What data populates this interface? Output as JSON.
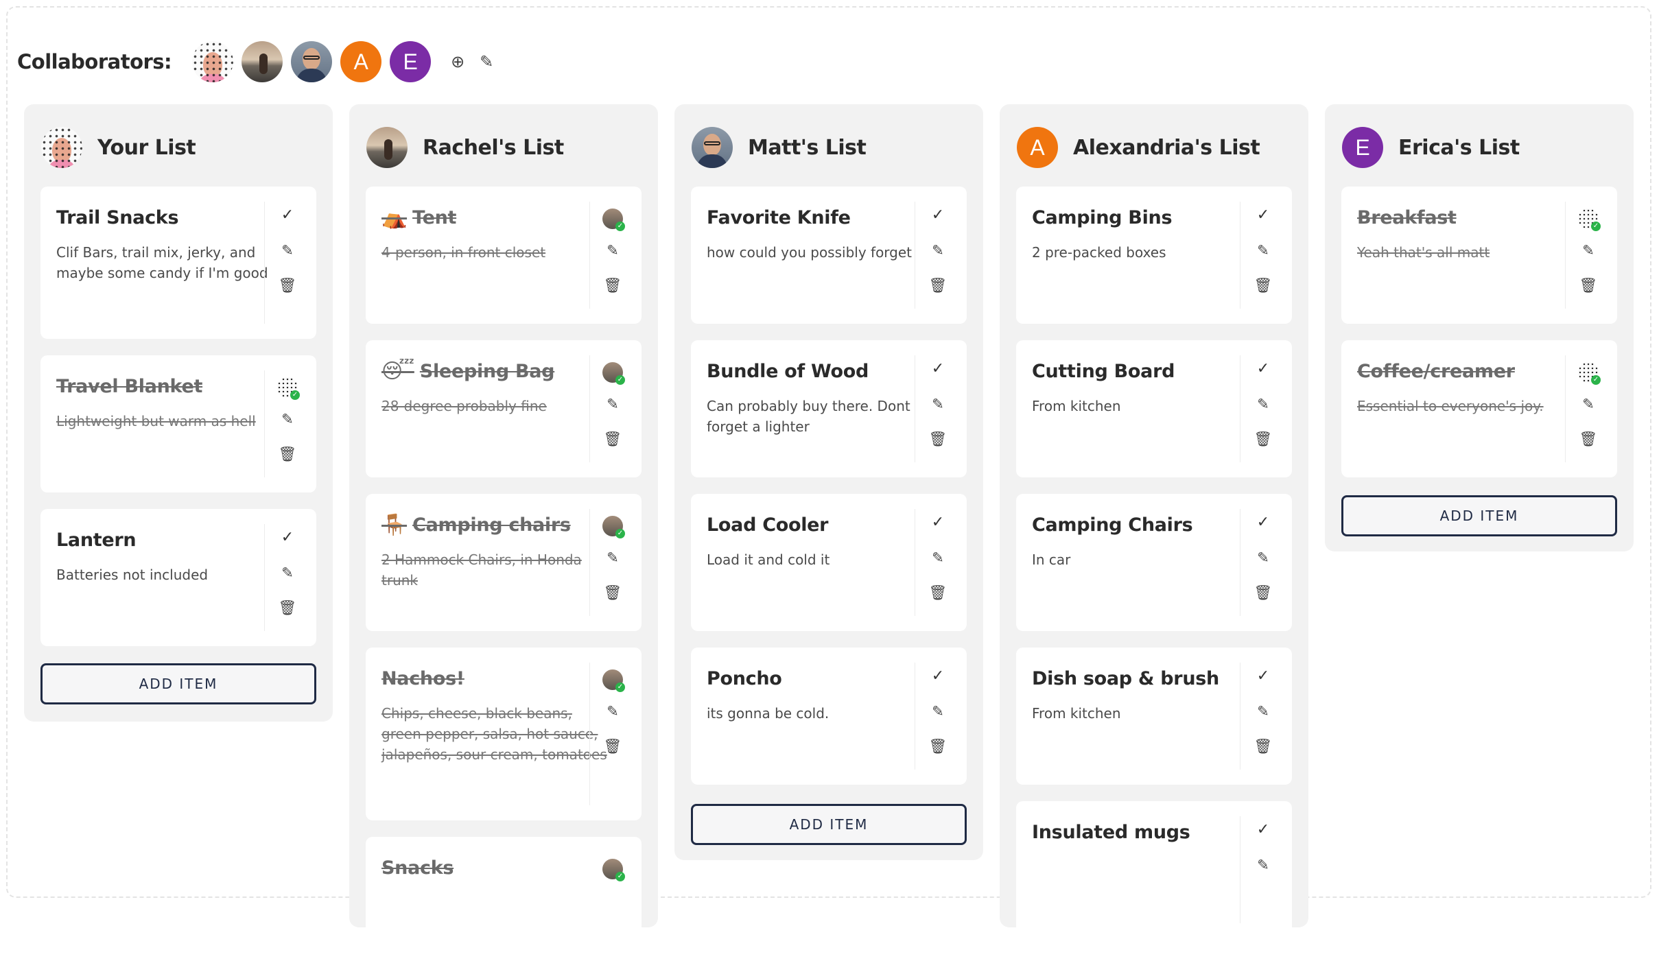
{
  "collaborators": {
    "title": "Collaborators:",
    "avatars": [
      {
        "name": "you",
        "letter": ""
      },
      {
        "name": "rachel",
        "letter": ""
      },
      {
        "name": "matt",
        "letter": ""
      },
      {
        "name": "alexandria",
        "letter": "A",
        "color": "#f0750f"
      },
      {
        "name": "erica",
        "letter": "E",
        "color": "#7b2ca6"
      }
    ],
    "add_icon": "plus-circle-icon",
    "edit_icon": "pencil-icon"
  },
  "columns": [
    {
      "title": "Your List",
      "cards": [
        {
          "title": "Trail Snacks",
          "desc": "Clif Bars, trail mix, jerky, and maybe some candy if I'm good",
          "done": false
        },
        {
          "title": "Travel Blanket",
          "desc": "Lightweight but warm as hell",
          "done": true
        },
        {
          "title": "Lantern",
          "desc": "Batteries not included",
          "done": false
        }
      ],
      "add_label": "ADD ITEM"
    },
    {
      "title": "Rachel's List",
      "cards": [
        {
          "title": "Tent",
          "desc": "4-person, in front closet",
          "done": true,
          "emoji": "⛺"
        },
        {
          "title": "Sleeping Bag",
          "desc": "28-degree probably fine",
          "done": true,
          "emoji": "😴"
        },
        {
          "title": "Camping chairs",
          "desc": "2 Hammock Chairs, in Honda trunk",
          "done": true,
          "emoji": "🪑"
        },
        {
          "title": "Nachos!",
          "desc": "Chips, cheese, black beans, green pepper, salsa, hot sauce, jalapeños, sour cream, tomatoes",
          "done": true
        },
        {
          "title": "Snacks",
          "desc": "",
          "done": true
        }
      ]
    },
    {
      "title": "Matt's List",
      "cards": [
        {
          "title": "Favorite Knife",
          "desc": "how could you possibly forget",
          "done": false
        },
        {
          "title": "Bundle of Wood",
          "desc": "Can probably buy there. Dont forget a lighter",
          "done": false
        },
        {
          "title": "Load Cooler",
          "desc": "Load it and cold it",
          "done": false
        },
        {
          "title": "Poncho",
          "desc": "its gonna be cold.",
          "done": false
        }
      ],
      "add_label": "ADD ITEM"
    },
    {
      "title": "Alexandria's List",
      "cards": [
        {
          "title": "Camping Bins",
          "desc": "2 pre-packed boxes",
          "done": false
        },
        {
          "title": "Cutting Board",
          "desc": "From kitchen",
          "done": false
        },
        {
          "title": "Camping Chairs",
          "desc": "In car",
          "done": false
        },
        {
          "title": "Dish soap & brush",
          "desc": "From kitchen",
          "done": false
        },
        {
          "title": "Insulated mugs",
          "desc": "",
          "done": false
        }
      ]
    },
    {
      "title": "Erica's List",
      "cards": [
        {
          "title": "Breakfast",
          "desc": "Yeah that's all matt",
          "done": true
        },
        {
          "title": "Coffee/creamer",
          "desc": "Essential to everyone's joy.",
          "done": true
        }
      ],
      "add_label": "ADD ITEM"
    }
  ],
  "icons": {
    "check": "check-icon",
    "edit": "pencil-icon",
    "delete": "trash-icon",
    "completed_by": "avatar-check-badge"
  }
}
